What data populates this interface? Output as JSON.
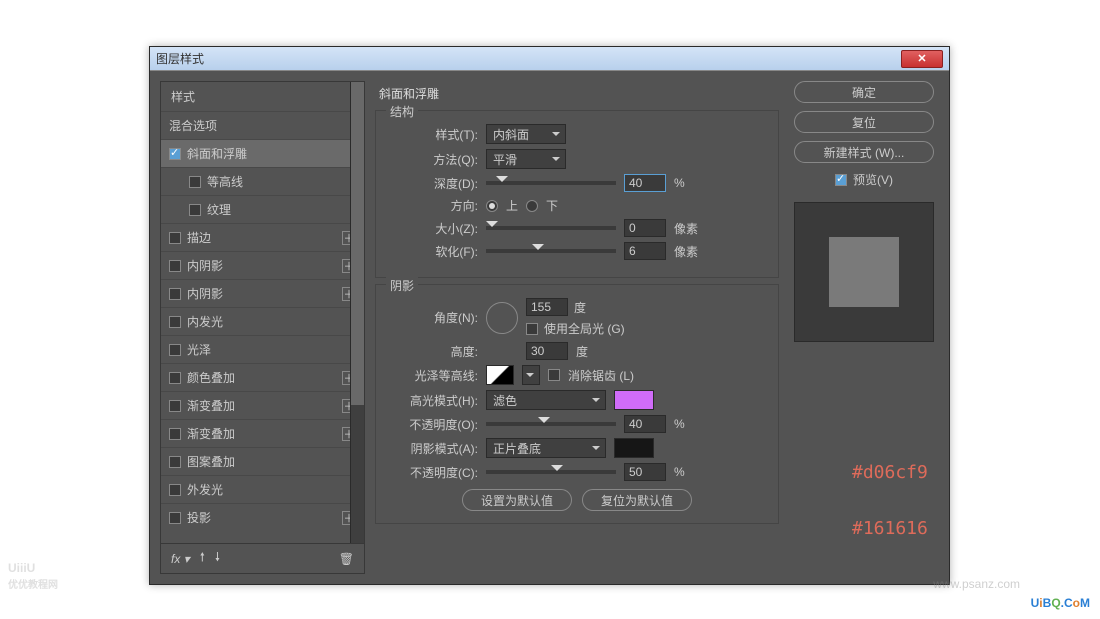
{
  "title": "图层样式",
  "styles": {
    "header": "样式",
    "blend": "混合选项",
    "items": [
      {
        "label": "斜面和浮雕",
        "checked": true,
        "active": true
      },
      {
        "label": "等高线",
        "checked": false,
        "sub": true
      },
      {
        "label": "纹理",
        "checked": false,
        "sub": true
      },
      {
        "label": "描边",
        "checked": false,
        "plus": true
      },
      {
        "label": "内阴影",
        "checked": false,
        "plus": true
      },
      {
        "label": "内阴影",
        "checked": false,
        "plus": true
      },
      {
        "label": "内发光",
        "checked": false
      },
      {
        "label": "光泽",
        "checked": false
      },
      {
        "label": "颜色叠加",
        "checked": false,
        "plus": true
      },
      {
        "label": "渐变叠加",
        "checked": false,
        "plus": true
      },
      {
        "label": "渐变叠加",
        "checked": false,
        "plus": true
      },
      {
        "label": "图案叠加",
        "checked": false
      },
      {
        "label": "外发光",
        "checked": false
      },
      {
        "label": "投影",
        "checked": false,
        "plus": true
      }
    ]
  },
  "main": {
    "title": "斜面和浮雕",
    "structure": {
      "legend": "结构",
      "styleLabel": "样式(T):",
      "styleVal": "内斜面",
      "techLabel": "方法(Q):",
      "techVal": "平滑",
      "depthLabel": "深度(D):",
      "depthVal": "40",
      "depthUnit": "%",
      "dirLabel": "方向:",
      "up": "上",
      "down": "下",
      "sizeLabel": "大小(Z):",
      "sizeVal": "0",
      "sizeUnit": "像素",
      "softLabel": "软化(F):",
      "softVal": "6",
      "softUnit": "像素"
    },
    "shading": {
      "legend": "阴影",
      "angleLabel": "角度(N):",
      "angleVal": "155",
      "deg": "度",
      "globalLabel": "使用全局光 (G)",
      "altLabel": "高度:",
      "altVal": "30",
      "glossLabel": "光泽等高线:",
      "antiLabel": "消除锯齿 (L)",
      "hlLabel": "高光模式(H):",
      "hlVal": "滤色",
      "hlColor": "#d06cf9",
      "hlOpLabel": "不透明度(O):",
      "hlOpVal": "40",
      "pct": "%",
      "shLabel": "阴影模式(A):",
      "shVal": "正片叠底",
      "shColor": "#161616",
      "shOpLabel": "不透明度(C):",
      "shOpVal": "50",
      "defaultBtn": "设置为默认值",
      "resetBtn": "复位为默认值"
    }
  },
  "buttons": {
    "ok": "确定",
    "cancel": "复位",
    "new": "新建样式 (W)...",
    "preview": "预览(V)"
  },
  "annot": {
    "c1": "#d06cf9",
    "c2": "#161616"
  },
  "wm": {
    "a": "UiiiU",
    "b": "优优教程网",
    "c": "www.psanz.com"
  }
}
